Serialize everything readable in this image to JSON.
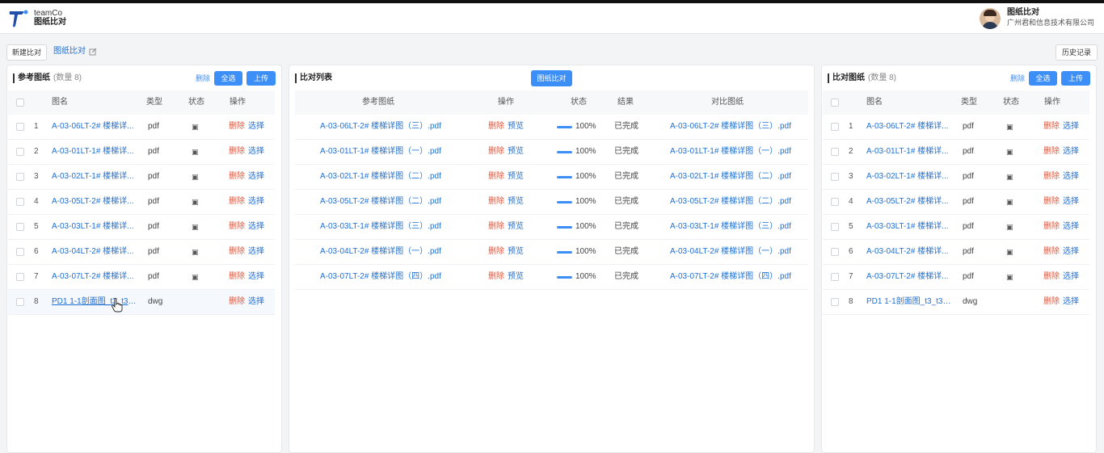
{
  "header": {
    "brand_top": "teamCo",
    "brand_bottom": "图纸比对",
    "user_title": "图纸比对",
    "user_company": "广州君和信息技术有限公司"
  },
  "toolbar": {
    "new_compare": "新建比对",
    "current_tab": "图纸比对",
    "history": "历史记录"
  },
  "left": {
    "title": "参考图纸",
    "count": "(数量 8)",
    "delete": "删除",
    "select_all": "全选",
    "upload": "上传",
    "headers": [
      "图名",
      "类型",
      "状态",
      "操作"
    ],
    "rows": [
      {
        "no": "1",
        "name": "A-03-06LT-2# 楼梯详...",
        "type": "pdf",
        "status": "▣",
        "del": "删除",
        "sel": "选择"
      },
      {
        "no": "2",
        "name": "A-03-01LT-1# 楼梯详...",
        "type": "pdf",
        "status": "▣",
        "del": "删除",
        "sel": "选择"
      },
      {
        "no": "3",
        "name": "A-03-02LT-1# 楼梯详...",
        "type": "pdf",
        "status": "▣",
        "del": "删除",
        "sel": "选择"
      },
      {
        "no": "4",
        "name": "A-03-05LT-2# 楼梯详...",
        "type": "pdf",
        "status": "▣",
        "del": "删除",
        "sel": "选择"
      },
      {
        "no": "5",
        "name": "A-03-03LT-1# 楼梯详...",
        "type": "pdf",
        "status": "▣",
        "del": "删除",
        "sel": "选择"
      },
      {
        "no": "6",
        "name": "A-03-04LT-2# 楼梯详...",
        "type": "pdf",
        "status": "▣",
        "del": "删除",
        "sel": "选择"
      },
      {
        "no": "7",
        "name": "A-03-07LT-2# 楼梯详...",
        "type": "pdf",
        "status": "▣",
        "del": "删除",
        "sel": "选择"
      },
      {
        "no": "8",
        "name": "PD1 1-1剖面图_t3_t3-d...",
        "type": "dwg",
        "status": "",
        "del": "删除",
        "sel": "选择"
      }
    ]
  },
  "middle": {
    "title": "比对列表",
    "compare_button": "图纸比对",
    "headers": [
      "参考图纸",
      "操作",
      "状态",
      "结果",
      "对比图纸"
    ],
    "rows": [
      {
        "ref": "A-03-06LT-2# 楼梯详图（三）.pdf",
        "del": "删除",
        "preview": "预览",
        "progress": "100%",
        "result": "已完成",
        "cmp": "A-03-06LT-2# 楼梯详图（三）.pdf"
      },
      {
        "ref": "A-03-01LT-1# 楼梯详图（一）.pdf",
        "del": "删除",
        "preview": "预览",
        "progress": "100%",
        "result": "已完成",
        "cmp": "A-03-01LT-1# 楼梯详图（一）.pdf"
      },
      {
        "ref": "A-03-02LT-1# 楼梯详图（二）.pdf",
        "del": "删除",
        "preview": "预览",
        "progress": "100%",
        "result": "已完成",
        "cmp": "A-03-02LT-1# 楼梯详图（二）.pdf"
      },
      {
        "ref": "A-03-05LT-2# 楼梯详图（二）.pdf",
        "del": "删除",
        "preview": "预览",
        "progress": "100%",
        "result": "已完成",
        "cmp": "A-03-05LT-2# 楼梯详图（二）.pdf"
      },
      {
        "ref": "A-03-03LT-1# 楼梯详图（三）.pdf",
        "del": "删除",
        "preview": "预览",
        "progress": "100%",
        "result": "已完成",
        "cmp": "A-03-03LT-1# 楼梯详图（三）.pdf"
      },
      {
        "ref": "A-03-04LT-2# 楼梯详图（一）.pdf",
        "del": "删除",
        "preview": "预览",
        "progress": "100%",
        "result": "已完成",
        "cmp": "A-03-04LT-2# 楼梯详图（一）.pdf"
      },
      {
        "ref": "A-03-07LT-2# 楼梯详图（四）.pdf",
        "del": "删除",
        "preview": "预览",
        "progress": "100%",
        "result": "已完成",
        "cmp": "A-03-07LT-2# 楼梯详图（四）.pdf"
      }
    ]
  },
  "right": {
    "title": "比对图纸",
    "count": "(数量 8)",
    "delete": "删除",
    "select_all": "全选",
    "upload": "上传",
    "headers": [
      "图名",
      "类型",
      "状态",
      "操作"
    ],
    "rows": [
      {
        "no": "1",
        "name": "A-03-06LT-2# 楼梯详...",
        "type": "pdf",
        "status": "▣",
        "del": "删除",
        "sel": "选择"
      },
      {
        "no": "2",
        "name": "A-03-01LT-1# 楼梯详...",
        "type": "pdf",
        "status": "▣",
        "del": "删除",
        "sel": "选择"
      },
      {
        "no": "3",
        "name": "A-03-02LT-1# 楼梯详...",
        "type": "pdf",
        "status": "▣",
        "del": "删除",
        "sel": "选择"
      },
      {
        "no": "4",
        "name": "A-03-05LT-2# 楼梯详...",
        "type": "pdf",
        "status": "▣",
        "del": "删除",
        "sel": "选择"
      },
      {
        "no": "5",
        "name": "A-03-03LT-1# 楼梯详...",
        "type": "pdf",
        "status": "▣",
        "del": "删除",
        "sel": "选择"
      },
      {
        "no": "6",
        "name": "A-03-04LT-2# 楼梯详...",
        "type": "pdf",
        "status": "▣",
        "del": "删除",
        "sel": "选择"
      },
      {
        "no": "7",
        "name": "A-03-07LT-2# 楼梯详...",
        "type": "pdf",
        "status": "▣",
        "del": "删除",
        "sel": "选择"
      },
      {
        "no": "8",
        "name": "PD1 1-1剖面图_t3_t3-...",
        "type": "dwg",
        "status": "",
        "del": "删除",
        "sel": "选择"
      }
    ]
  }
}
